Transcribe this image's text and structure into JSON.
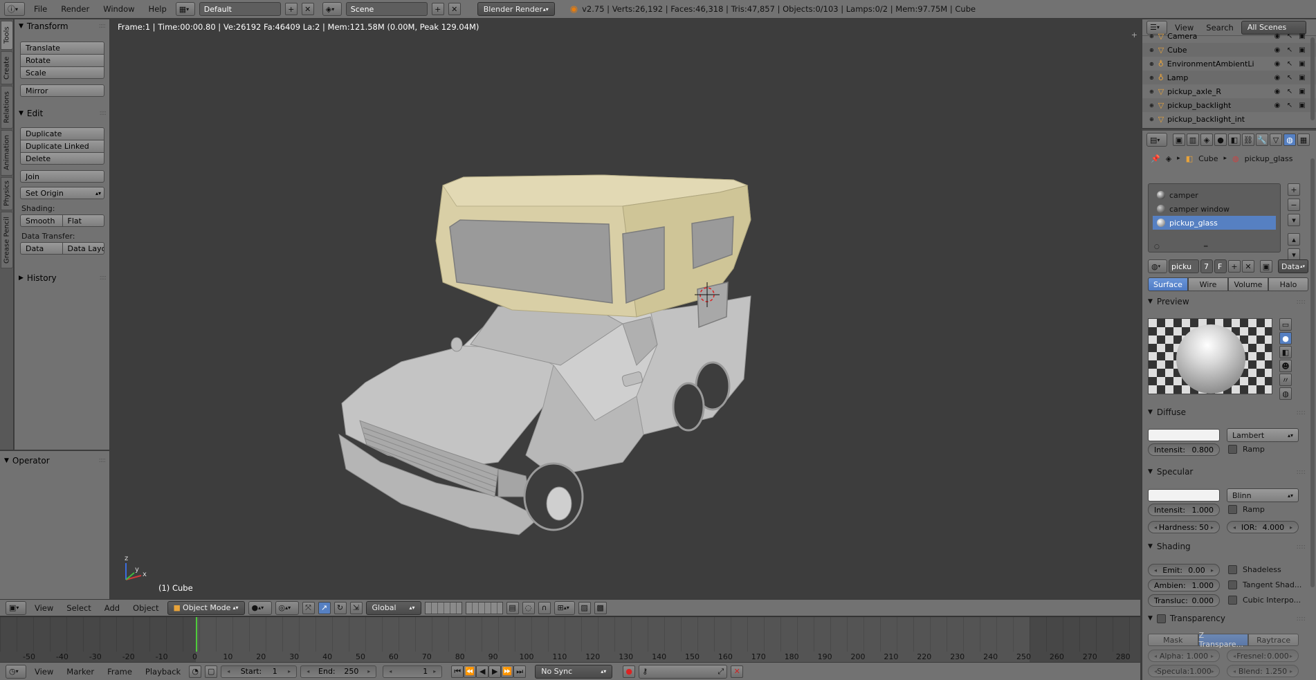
{
  "topbar": {
    "menus": [
      "File",
      "Render",
      "Window",
      "Help"
    ],
    "screen_layout": "Default",
    "scene": "Scene",
    "render_engine": "Blender Render",
    "stats": "v2.75 | Verts:26,192 | Faces:46,318 | Tris:47,857 | Objects:0/103 | Lamps:0/2 | Mem:97.75M | Cube"
  },
  "left_tabs": [
    "Tools",
    "Create",
    "Relations",
    "Animation",
    "Physics",
    "Grease Pencil"
  ],
  "tools": {
    "transform_title": "Transform",
    "translate": "Translate",
    "rotate": "Rotate",
    "scale": "Scale",
    "mirror": "Mirror",
    "edit_title": "Edit",
    "duplicate": "Duplicate",
    "duplicate_linked": "Duplicate Linked",
    "delete": "Delete",
    "join": "Join",
    "set_origin": "Set Origin",
    "shading_label": "Shading:",
    "smooth": "Smooth",
    "flat": "Flat",
    "data_transfer_label": "Data Transfer:",
    "data": "Data",
    "data_layout": "Data Layo",
    "history_title": "History",
    "operator_title": "Operator"
  },
  "viewport": {
    "info": "Frame:1 | Time:00:00.80 | Ve:26192 Fa:46409 La:2 | Mem:121.58M (0.00M, Peak 129.04M)",
    "object_label": "(1) Cube",
    "axis_x": "x",
    "axis_y": "y",
    "axis_z": "z"
  },
  "viewport_header": {
    "menus": [
      "View",
      "Select",
      "Add",
      "Object"
    ],
    "mode": "Object Mode",
    "orientation": "Global"
  },
  "timeline": {
    "ticks": [
      "-50",
      "-40",
      "-30",
      "-20",
      "-10",
      "0",
      "10",
      "20",
      "30",
      "40",
      "50",
      "60",
      "70",
      "80",
      "90",
      "100",
      "110",
      "120",
      "130",
      "140",
      "150",
      "160",
      "170",
      "180",
      "190",
      "200",
      "210",
      "220",
      "230",
      "240",
      "250",
      "260",
      "270",
      "280"
    ],
    "current_frame_marker": "0"
  },
  "timeline_header": {
    "menus": [
      "View",
      "Marker",
      "Frame",
      "Playback"
    ],
    "start_label": "Start:",
    "start_value": "1",
    "end_label": "End:",
    "end_value": "250",
    "current_frame": "1",
    "sync": "No Sync"
  },
  "outliner": {
    "menus": [
      "View",
      "Search"
    ],
    "filter": "All Scenes",
    "items": [
      "Camera",
      "Cube",
      "EnvironmentAmbientLi",
      "Lamp",
      "pickup_axle_R",
      "pickup_backlight",
      "pickup_backlight_int"
    ]
  },
  "properties": {
    "breadcrumb_object": "Cube",
    "breadcrumb_material": "pickup_glass",
    "material_slots": [
      "camper",
      "camper window",
      "pickup_glass"
    ],
    "selected_slot": "pickup_glass",
    "material_name": "picku",
    "users": "7",
    "fake_user": "F",
    "link": "Data",
    "tabs": [
      "Surface",
      "Wire",
      "Volume",
      "Halo"
    ],
    "active_tab": "Surface",
    "preview_title": "Preview",
    "diffuse_title": "Diffuse",
    "diffuse_shader": "Lambert",
    "diffuse_intensity_label": "Intensit:",
    "diffuse_intensity": "0.800",
    "ramp": "Ramp",
    "specular_title": "Specular",
    "specular_shader": "Blinn",
    "specular_intensity_label": "Intensit:",
    "specular_intensity": "1.000",
    "hardness_label": "Hardness:",
    "hardness": "50",
    "ior_label": "IOR:",
    "ior": "4.000",
    "shading_title": "Shading",
    "emit_label": "Emit:",
    "emit": "0.00",
    "ambient_label": "Ambien:",
    "ambient": "1.000",
    "transluc_label": "Transluc:",
    "transluc": "0.000",
    "shadeless": "Shadeless",
    "tangent_shading": "Tangent Shad...",
    "cubic_interp": "Cubic Interpo...",
    "transparency_title": "Transparency",
    "transp_modes": [
      "Mask",
      "Z Transpare...",
      "Raytrace"
    ],
    "transp_active": "Z Transpare...",
    "alpha_label": "Alpha:",
    "alpha": "1.000",
    "fresnel_label": "Fresnel:",
    "fresnel": "0.000",
    "specular_alpha_label": "Specula:",
    "specular_alpha": "1.000",
    "blend_label": "Blend:",
    "blend": "1.250"
  },
  "colors": {
    "panel": "#727272",
    "viewport": "#3d3d3d",
    "selection": "#5680c2",
    "camper": "#d9cfa6",
    "truck": "#c8c8c8"
  }
}
